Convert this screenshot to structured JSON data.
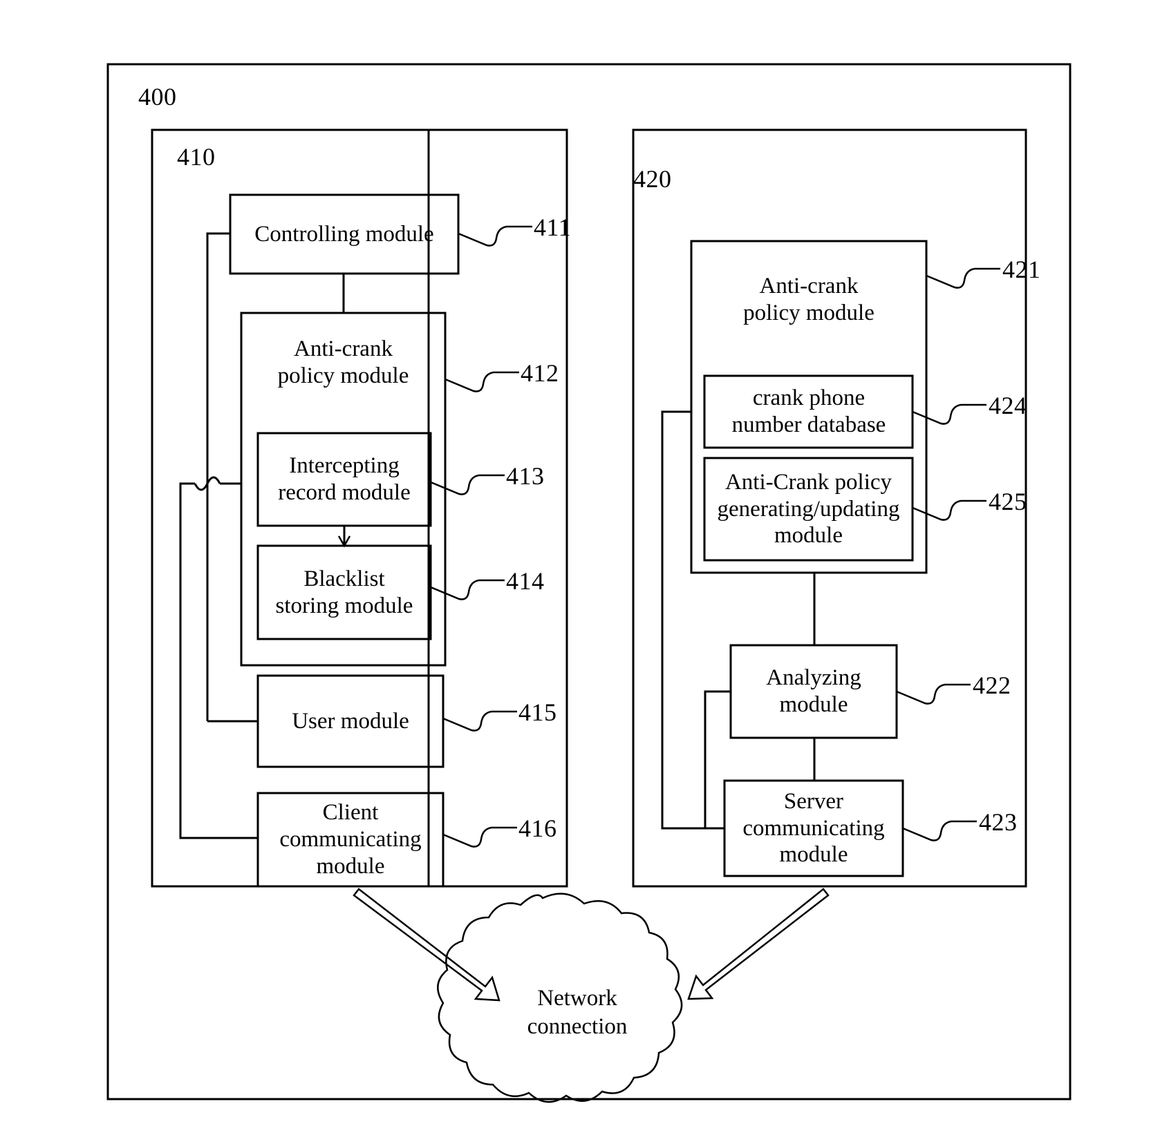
{
  "figure": {
    "outer_label": "400",
    "client_group_label": "410",
    "server_group_label": "420",
    "line_color": "#000000",
    "background": "#ffffff"
  },
  "client_side": {
    "group_ref": "410",
    "boxes": [
      {
        "ref": "411",
        "label": "Controlling module"
      },
      {
        "ref": "412",
        "label": "Anti-crank\npolicy module"
      },
      {
        "ref": "413",
        "label": "Intercepting\nrecord module"
      },
      {
        "ref": "414",
        "label": "Blacklist\nstoring module"
      },
      {
        "ref": "415",
        "label": "User module"
      },
      {
        "ref": "416",
        "label": "Client\ncommunicating\nmodule"
      }
    ]
  },
  "server_side": {
    "group_ref": "420",
    "boxes": [
      {
        "ref": "421",
        "label": "Anti-crank\npolicy module"
      },
      {
        "ref": "424",
        "label": "crank phone\nnumber database"
      },
      {
        "ref": "425",
        "label": "Anti-Crank policy\ngenerating/updating\nmodule"
      },
      {
        "ref": "422",
        "label": "Analyzing\nmodule"
      },
      {
        "ref": "423",
        "label": "Server\ncommunicating\nmodule"
      }
    ]
  },
  "network": {
    "label": "Network\nconnection"
  }
}
